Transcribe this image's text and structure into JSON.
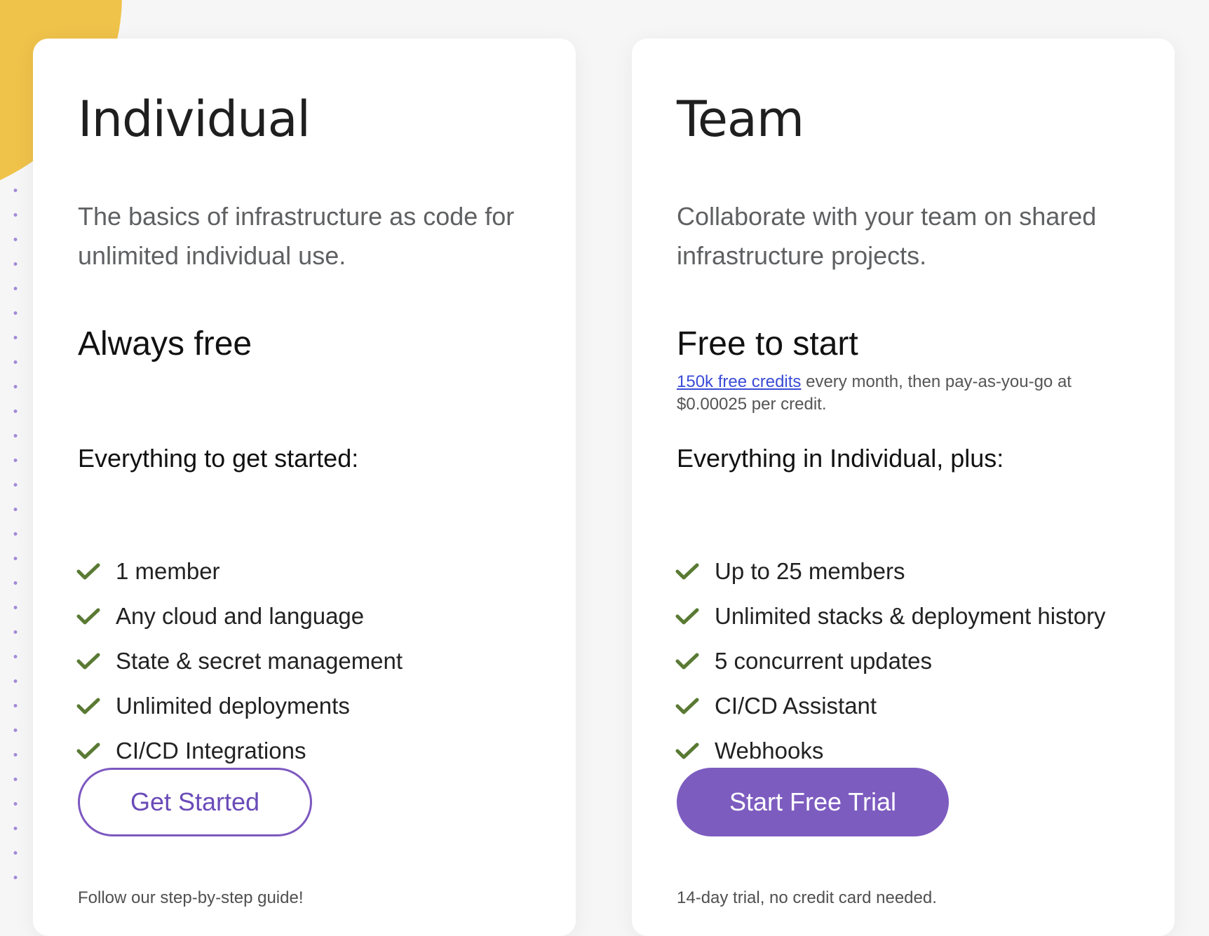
{
  "plans": {
    "individual": {
      "title": "Individual",
      "description": "The basics of infrastructure as code for unlimited individual use.",
      "price": "Always free",
      "features_heading": "Everything to get started:",
      "features": [
        "1 member",
        "Any cloud and language",
        "State & secret management",
        "Unlimited deployments",
        "CI/CD Integrations"
      ],
      "cta_label": "Get Started",
      "cta_note": "Follow our step-by-step guide!"
    },
    "team": {
      "title": "Team",
      "description": "Collaborate with your team on shared infrastructure projects.",
      "price": "Free to start",
      "price_note_link": "150k free credits",
      "price_note_text": " every month, then pay-as-you-go at $0.00025 per credit.",
      "features_heading": "Everything in Individual, plus:",
      "features": [
        "Up to 25 members",
        "Unlimited stacks & deployment history",
        "5 concurrent updates",
        "CI/CD Assistant",
        "Webhooks"
      ],
      "cta_label": "Start Free Trial",
      "cta_note": "14-day trial, no credit card needed."
    }
  },
  "icons": {
    "feature_check": "check-icon"
  },
  "colors": {
    "accent_purple": "#7d5cc0",
    "check_green": "#5a7a34",
    "decor_yellow": "#efc24a"
  }
}
